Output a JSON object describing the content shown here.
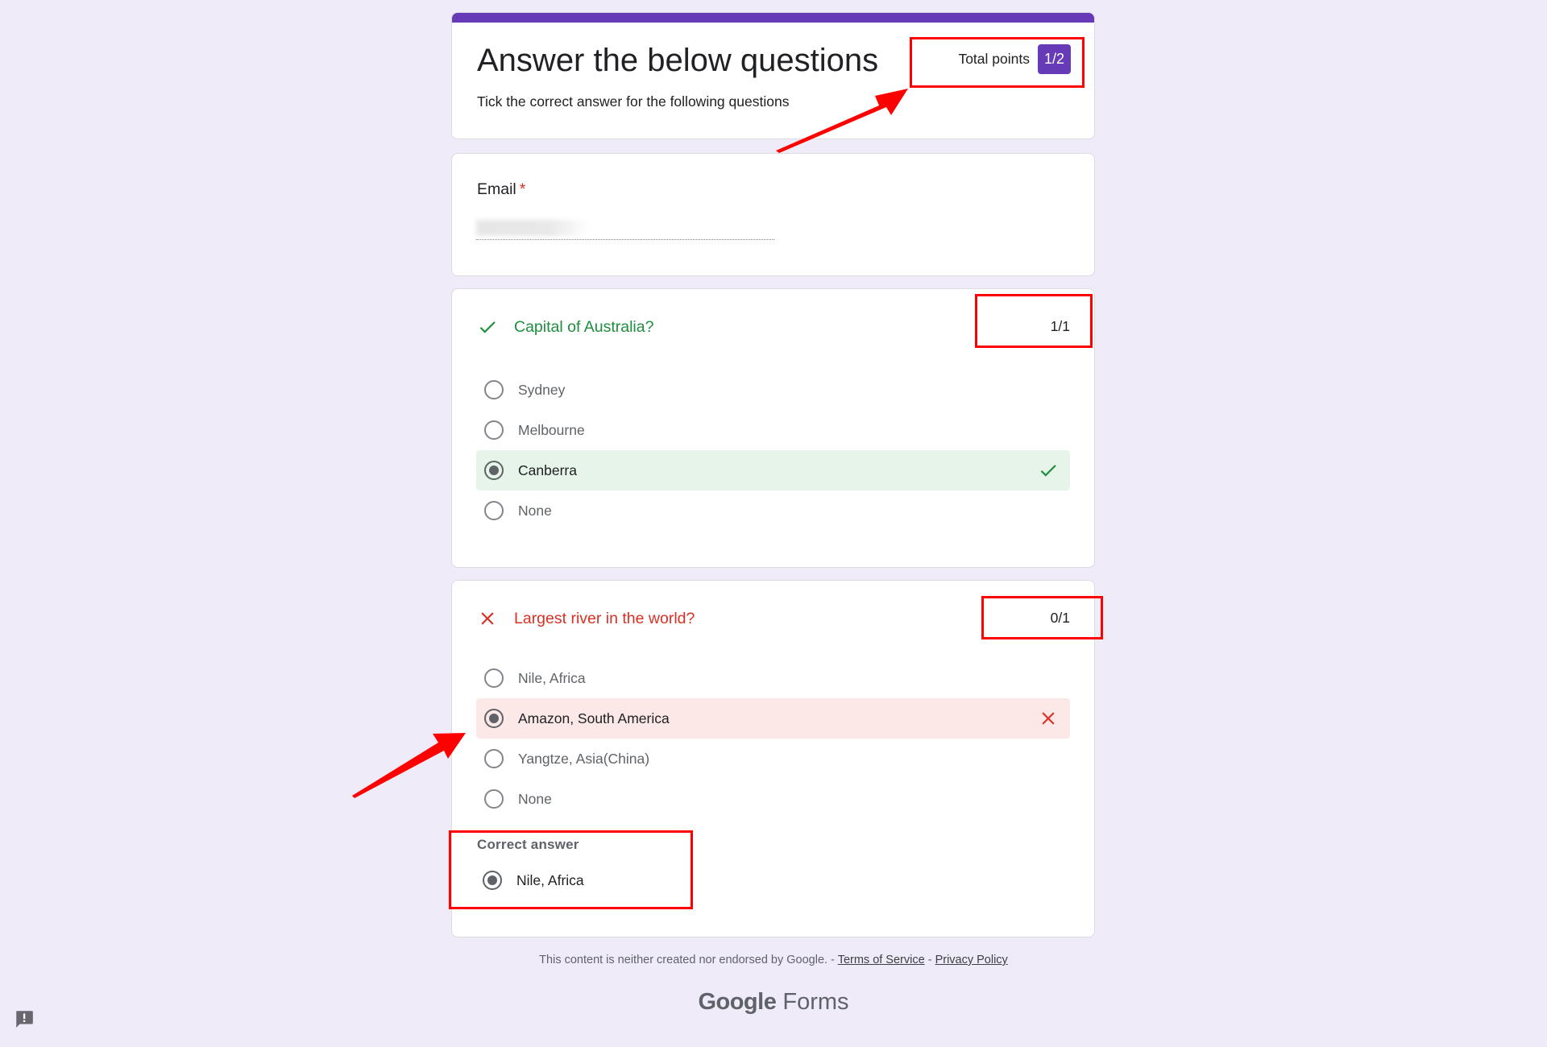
{
  "header": {
    "title": "Answer the below questions",
    "description": "Tick the correct answer for the following questions",
    "total_points_label": "Total points",
    "total_points_value": "1/2",
    "accent_color": "#673ab7"
  },
  "email": {
    "label": "Email",
    "required_marker": "*",
    "value_redacted": true
  },
  "questions": [
    {
      "title": "Capital of Australia?",
      "status": "correct",
      "status_icon": "check-icon",
      "score": "1/1",
      "options": [
        {
          "label": "Sydney",
          "selected": false
        },
        {
          "label": "Melbourne",
          "selected": false
        },
        {
          "label": "Canberra",
          "selected": true,
          "result": "correct"
        },
        {
          "label": "None",
          "selected": false
        }
      ]
    },
    {
      "title": "Largest river in the world?",
      "status": "incorrect",
      "status_icon": "close-icon",
      "score": "0/1",
      "options": [
        {
          "label": "Nile, Africa",
          "selected": false
        },
        {
          "label": "Amazon, South America",
          "selected": true,
          "result": "incorrect"
        },
        {
          "label": "Yangtze, Asia(China)",
          "selected": false
        },
        {
          "label": "None",
          "selected": false
        }
      ],
      "correct_answer_label": "Correct answer",
      "correct_answer": "Nile, Africa"
    }
  ],
  "footer": {
    "disclaimer": "This content is neither created nor endorsed by Google. - ",
    "separator": " - ",
    "terms_link": "Terms of Service",
    "privacy_link": "Privacy Policy",
    "logo_google": "Google",
    "logo_forms": " Forms"
  },
  "colors": {
    "background": "#f0ebf8",
    "correct": "#1e8e3e",
    "incorrect": "#d93025",
    "correct_bg": "#e6f4ea",
    "incorrect_bg": "#fce8e6",
    "annotation": "#ff0000"
  }
}
